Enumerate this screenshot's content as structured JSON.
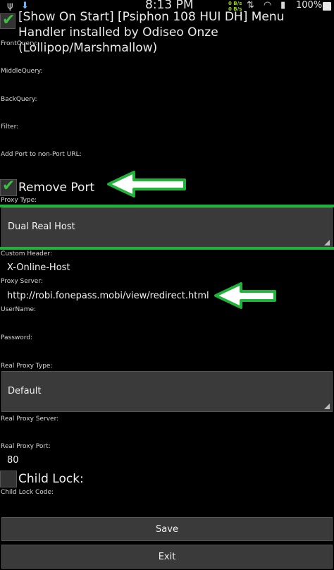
{
  "status_bar": {
    "time": "8:13 PM",
    "battery_text": "100%",
    "net_speed_up": "0 B/s",
    "net_speed_down": "0 B/s"
  },
  "header": {
    "text": "[Show On Start] [Psiphon 108 HUI DH] Menu Handler installed by Odiseo Onze (Lollipop/Marshmallow)",
    "checked": true
  },
  "fields": {
    "front_query_label": "FrontQuery:",
    "middle_query_label": "MiddleQuery:",
    "back_query_label": "BackQuery:",
    "filter_label": "Filter:",
    "add_port_label": "Add Port to non-Port URL:",
    "remove_port_label": "Remove Port",
    "proxy_type_label": "Proxy Type:",
    "proxy_type_value": "Dual Real Host",
    "custom_header_label": "Custom Header:",
    "custom_header_value": "X-Online-Host",
    "proxy_server_label": "Proxy Server:",
    "proxy_server_value": "http://robi.fonepass.mobi/view/redirect.html",
    "username_label": "UserName:",
    "password_label": "Password:",
    "real_proxy_type_label": "Real Proxy Type:",
    "real_proxy_type_value": "Default",
    "real_proxy_server_label": "Real Proxy Server:",
    "real_proxy_port_label": "Real Proxy Port:",
    "real_proxy_port_value": "80",
    "child_lock_label": "Child Lock:",
    "child_lock_code_label": "Child Lock Code:"
  },
  "buttons": {
    "save": "Save",
    "exit": "Exit"
  },
  "colors": {
    "accent_green": "#1fb33a",
    "check_green": "#3fbf3f"
  }
}
